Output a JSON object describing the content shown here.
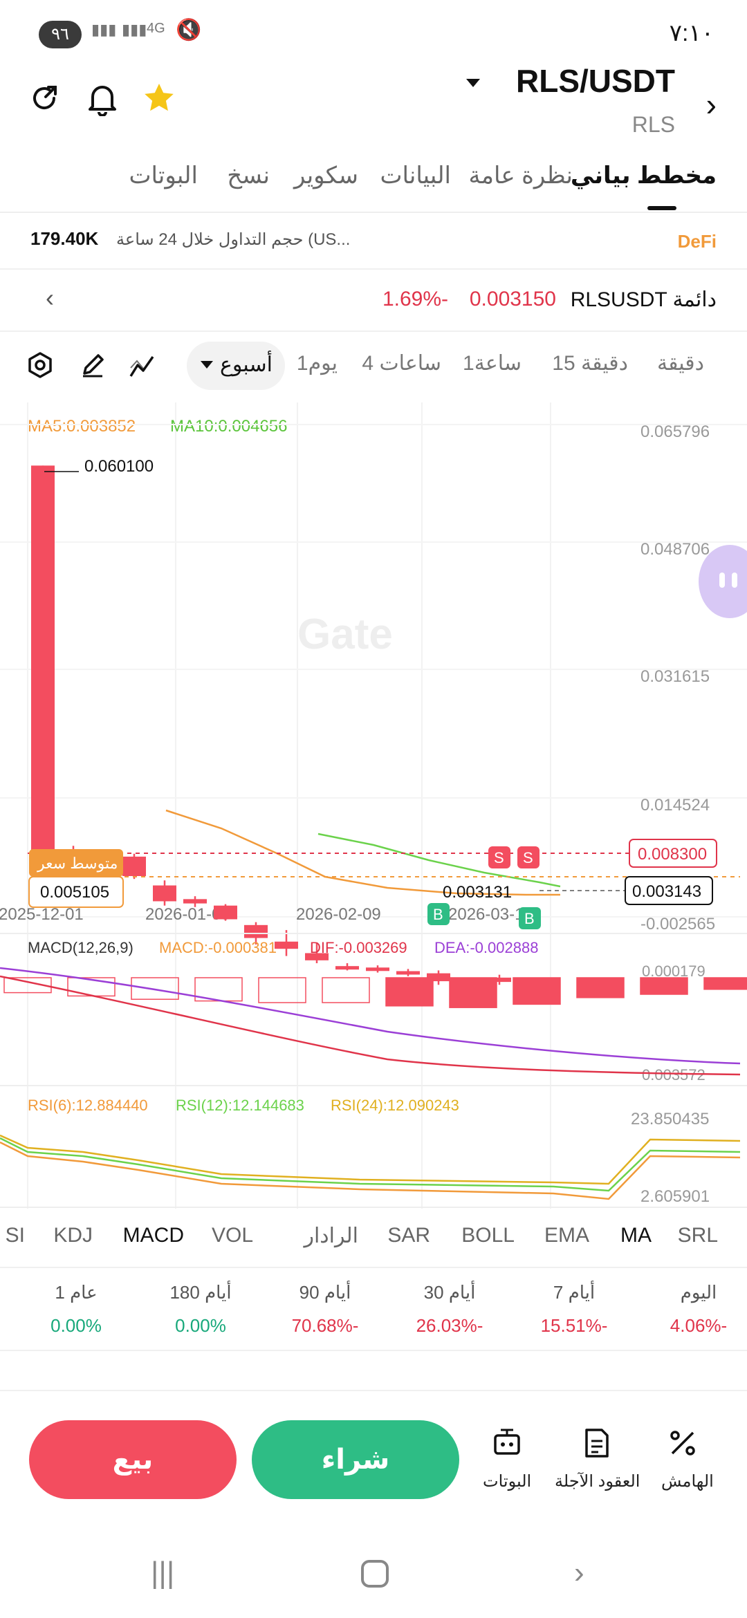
{
  "status_bar": {
    "time": "٧:١٠",
    "battery": "٩٦",
    "signal_4g": "4G"
  },
  "header": {
    "pair": "RLS/USDT",
    "sub": "RLS"
  },
  "tabs": [
    {
      "label": "مخطط بياني"
    },
    {
      "label": "نظرة عامة"
    },
    {
      "label": "البيانات"
    },
    {
      "label": "سكوير"
    },
    {
      "label": "نسخ"
    },
    {
      "label": "البوتات"
    }
  ],
  "volume": {
    "label": "حجم التداول خلال 24 ساعة (US...",
    "value": "179.40K",
    "tag": "DeFi"
  },
  "perp": {
    "name": "RLSUSDT دائمة",
    "price": "0.003150",
    "change": "1.69%-"
  },
  "timeframes": [
    "دقيقة",
    "15 دقيقة",
    "1ساعة",
    "4 ساعات",
    "1يوم"
  ],
  "selected_timeframe": "أسبوع",
  "chart_data": {
    "type": "candlestick",
    "watermark": "Gate",
    "ma_labels": {
      "ma5": "MA5:0.003852",
      "ma10": "MA10:0.004656"
    },
    "y_ticks": [
      "0.065796",
      "0.048706",
      "0.031615",
      "0.014524",
      "-0.002565"
    ],
    "x_ticks": [
      "2025-12-01",
      "2026-01-05",
      "2026-02-09",
      "2026-03-16"
    ],
    "max_label": "0.060100",
    "price_tags": {
      "sell_level": "0.008300",
      "last_price": "0.003143",
      "low_label": "0.003131",
      "avg_price": "0.005105",
      "avg_label": "متوسط سعر"
    },
    "candles": [
      {
        "o": 0.0601,
        "c": 0.0055,
        "h": 0.0601,
        "l": 0.0034,
        "dir": "down"
      },
      {
        "o": 0.0062,
        "c": 0.0041,
        "h": 0.0073,
        "l": 0.0026,
        "dir": "down"
      },
      {
        "o": 0.0041,
        "c": 0.0057,
        "h": 0.0063,
        "l": 0.0032,
        "dir": "up"
      },
      {
        "o": 0.0058,
        "c": 0.0031,
        "h": 0.0062,
        "l": 0.0027,
        "dir": "down"
      },
      {
        "o": 0.0018,
        "c": -0.0004,
        "h": 0.0025,
        "l": -0.001,
        "dir": "down"
      },
      {
        "o": -0.0001,
        "c": -0.0007,
        "h": 0.0003,
        "l": -0.0012,
        "dir": "down"
      },
      {
        "o": -0.001,
        "c": -0.0029,
        "h": -0.0008,
        "l": -0.0031,
        "dir": "down"
      },
      {
        "o": -0.0037,
        "c": -0.0055,
        "h": -0.0033,
        "l": -0.0064,
        "dir": "down"
      },
      {
        "o": -0.006,
        "c": -0.007,
        "h": -0.0044,
        "l": -0.008,
        "dir": "down"
      },
      {
        "o": -0.0076,
        "c": -0.0086,
        "h": -0.0061,
        "l": -0.009,
        "dir": "down"
      },
      {
        "o": -0.0094,
        "c": -0.0097,
        "h": -0.009,
        "l": -0.01,
        "dir": "down"
      },
      {
        "o": -0.0096,
        "c": -0.0099,
        "h": -0.0093,
        "l": -0.0103,
        "dir": "down"
      },
      {
        "o": -0.0101,
        "c": -0.0105,
        "h": -0.0098,
        "l": -0.0108,
        "dir": "down"
      },
      {
        "o": -0.0104,
        "c": -0.0115,
        "h": -0.01,
        "l": -0.012,
        "dir": "down"
      },
      {
        "o": -0.0113,
        "c": -0.011,
        "h": -0.011,
        "l": -0.0115,
        "dir": "up"
      },
      {
        "o": -0.011,
        "c": -0.0116,
        "h": -0.0106,
        "l": -0.012,
        "dir": "down"
      }
    ],
    "macd": {
      "label": "MACD(12,26,9)",
      "macd": "MACD:-0.000381",
      "dif": "DIF:-0.003269",
      "dea": "DEA:-0.002888",
      "y_top": "0.000179",
      "y_bottom": "0.003572"
    },
    "rsi": {
      "r6": "RSI(6):12.884440",
      "r12": "RSI(12):12.144683",
      "r24": "RSI(24):12.090243",
      "y_top": "23.850435",
      "y_bottom": "2.605901"
    }
  },
  "indicator_tabs": [
    "SRL",
    "MA",
    "EMA",
    "BOLL",
    "SAR",
    "الرادار",
    "VOL",
    "MACD",
    "KDJ",
    "SI"
  ],
  "performance": [
    {
      "label": "اليوم",
      "value": "4.06%-",
      "dir": "down"
    },
    {
      "label": "7 أيام",
      "value": "15.51%-",
      "dir": "down"
    },
    {
      "label": "30 أيام",
      "value": "26.03%-",
      "dir": "down"
    },
    {
      "label": "90 أيام",
      "value": "70.68%-",
      "dir": "down"
    },
    {
      "label": "180 أيام",
      "value": "0.00%",
      "dir": "up"
    },
    {
      "label": "1 عام",
      "value": "0.00%",
      "dir": "up"
    }
  ],
  "actions": {
    "sell": "بيع",
    "buy": "شراء",
    "bots": "البوتات",
    "futures": "العقود الآجلة",
    "margin": "الهامش"
  },
  "colors": {
    "up": "#2ebd85",
    "down": "#f34d5f",
    "ma5": "#f19a3a",
    "ma10": "#6bd24b",
    "accent": "#f5c518"
  }
}
